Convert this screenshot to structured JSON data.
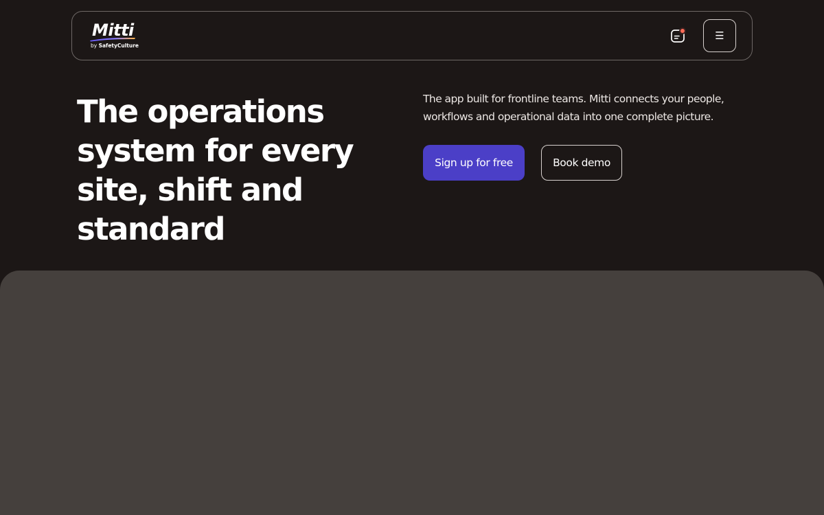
{
  "header": {
    "logo": {
      "name": "Mitti",
      "by_prefix": "by",
      "by_brand": "SafetyCulture"
    },
    "chat_icon": "chat-notification-icon",
    "menu_icon": "hamburger-menu-icon",
    "menu_glyph": "☰"
  },
  "hero": {
    "title": "The operations system for every site, shift and standard",
    "description": "The app built for frontline teams. Mitti connects your people, workflows and operational data into one complete picture.",
    "primary_cta": "Sign up for free",
    "secondary_cta": "Book demo"
  },
  "colors": {
    "background": "#1c1716",
    "accent": "#4b3fc7",
    "notification_dot": "#ff6b57",
    "media_panel": "#45403d"
  }
}
